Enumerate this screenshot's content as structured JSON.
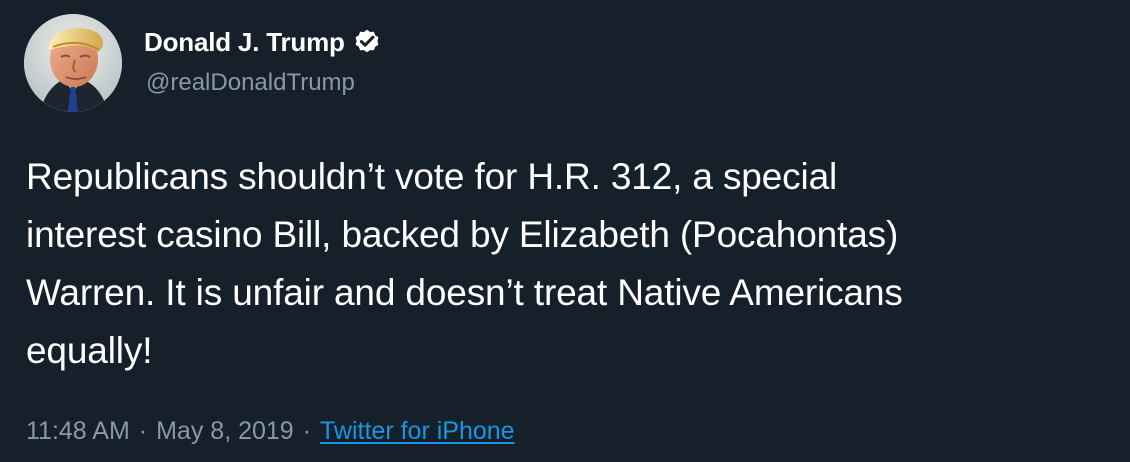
{
  "theme": {
    "background": "#15202b",
    "primary_text": "#ffffff",
    "secondary_text": "#8899a6",
    "link": "#1b95e0",
    "verified_badge": "#ffffff"
  },
  "user": {
    "avatar_icon": "profile-avatar",
    "display_name": "Donald J. Trump",
    "verified_icon": "verified-badge",
    "handle": "@realDonaldTrump"
  },
  "tweet": {
    "text": "Republicans shouldn’t vote for H.R. 312, a special\ninterest casino Bill, backed by Elizabeth (Pocahontas)\nWarren. It is unfair and doesn’t treat Native Americans\nequally!"
  },
  "meta": {
    "time": "11:48 AM",
    "separator_1": "·",
    "date": "May 8, 2019",
    "separator_2": "·",
    "source": "Twitter for iPhone"
  }
}
